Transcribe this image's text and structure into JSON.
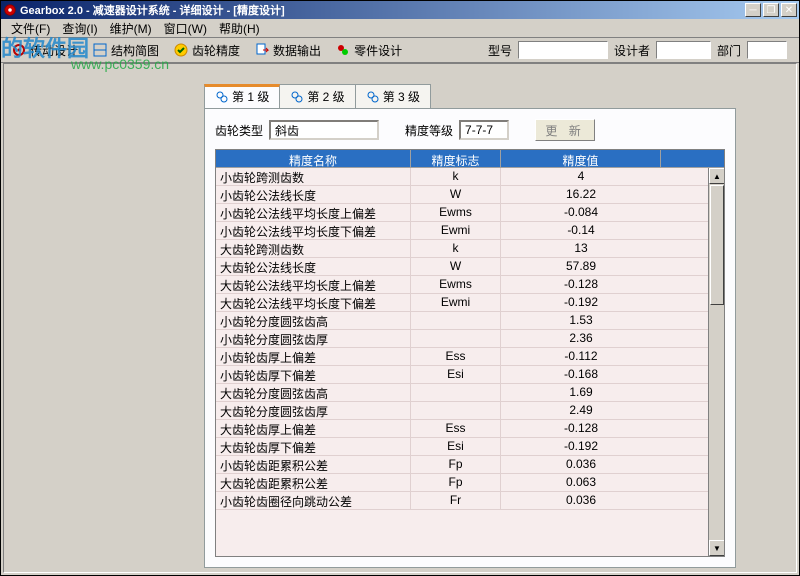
{
  "window": {
    "title": "Gearbox 2.0 - 减速器设计系统 - 详细设计 - [精度设计]"
  },
  "menu": {
    "file": "文件(F)",
    "query": "查询(I)",
    "maintain": "维护(M)",
    "window": "窗口(W)",
    "help": "帮助(H)"
  },
  "toolbar": {
    "transmission": "传动设计",
    "structure": "结构简图",
    "precision": "齿轮精度",
    "output": "数据输出",
    "parts": "零件设计",
    "model_label": "型号",
    "model_value": "",
    "designer_label": "设计者",
    "designer_value": "",
    "dept_label": "部门",
    "dept_value": ""
  },
  "tabs": {
    "tab1": "第 1 级",
    "tab2": "第 2 级",
    "tab3": "第 3 级"
  },
  "form": {
    "gear_type_label": "齿轮类型",
    "gear_type_value": "斜齿",
    "precision_grade_label": "精度等级",
    "precision_grade_value": "7-7-7",
    "update_btn": "更 新"
  },
  "table": {
    "headers": {
      "name": "精度名称",
      "symbol": "精度标志",
      "value": "精度值"
    },
    "rows": [
      {
        "name": "小齿轮跨测齿数",
        "symbol": "k",
        "value": "4"
      },
      {
        "name": "小齿轮公法线长度",
        "symbol": "W",
        "value": "16.22"
      },
      {
        "name": "小齿轮公法线平均长度上偏差",
        "symbol": "Ewms",
        "value": "-0.084"
      },
      {
        "name": "小齿轮公法线平均长度下偏差",
        "symbol": "Ewmi",
        "value": "-0.14"
      },
      {
        "name": "大齿轮跨测齿数",
        "symbol": "k",
        "value": "13"
      },
      {
        "name": "大齿轮公法线长度",
        "symbol": "W",
        "value": "57.89"
      },
      {
        "name": "大齿轮公法线平均长度上偏差",
        "symbol": "Ewms",
        "value": "-0.128"
      },
      {
        "name": "大齿轮公法线平均长度下偏差",
        "symbol": "Ewmi",
        "value": "-0.192"
      },
      {
        "name": "小齿轮分度圆弦齿高",
        "symbol": "",
        "value": "1.53"
      },
      {
        "name": "小齿轮分度圆弦齿厚",
        "symbol": "",
        "value": "2.36"
      },
      {
        "name": "小齿轮齿厚上偏差",
        "symbol": "Ess",
        "value": "-0.112"
      },
      {
        "name": "小齿轮齿厚下偏差",
        "symbol": "Esi",
        "value": "-0.168"
      },
      {
        "name": "大齿轮分度圆弦齿高",
        "symbol": "",
        "value": "1.69"
      },
      {
        "name": "大齿轮分度圆弦齿厚",
        "symbol": "",
        "value": "2.49"
      },
      {
        "name": "大齿轮齿厚上偏差",
        "symbol": "Ess",
        "value": "-0.128"
      },
      {
        "name": "大齿轮齿厚下偏差",
        "symbol": "Esi",
        "value": "-0.192"
      },
      {
        "name": "小齿轮齿距累积公差",
        "symbol": "Fp",
        "value": "0.036"
      },
      {
        "name": "大齿轮齿距累积公差",
        "symbol": "Fp",
        "value": "0.063"
      },
      {
        "name": "小齿轮齿圈径向跳动公差",
        "symbol": "Fr",
        "value": "0.036"
      }
    ]
  },
  "watermark": {
    "main": "的软件园",
    "sub": "www.pc0359.cn"
  }
}
